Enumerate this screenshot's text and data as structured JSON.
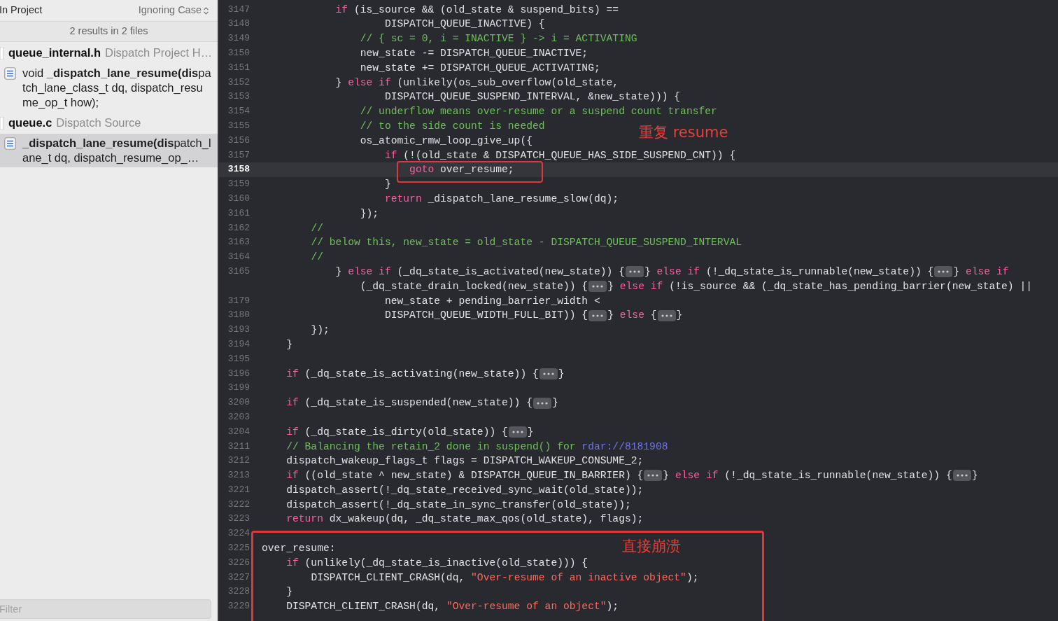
{
  "find_panel": {
    "scope": "In Project",
    "case_option": "Ignoring Case",
    "summary": "2 results in 2 files",
    "results": [
      {
        "kind": "file",
        "name": "queue_internal.h",
        "location": "Dispatch Project H…",
        "selected": false
      },
      {
        "kind": "match",
        "text": "void **_dispatch_lane_resume(dis**patch_lane_class_t dq, dispatch_resume_op_t how);",
        "selected": false
      },
      {
        "kind": "file",
        "name": "queue.c",
        "location": "Dispatch Source",
        "selected": false
      },
      {
        "kind": "match",
        "text": "**_dispatch_lane_resume(dis**patch_lane_t dq, dispatch_resume_op_…",
        "selected": true
      }
    ],
    "filter": {
      "placeholder": "Filter"
    }
  },
  "code_lines": [
    {
      "number": "3147",
      "current": false,
      "segments": [
        {
          "kind": "keyword",
          "text": "            if"
        },
        {
          "kind": "plain",
          "text": " (is_source && (old_state & suspend_bits) =="
        }
      ]
    },
    {
      "number": "3148",
      "current": false,
      "segments": [
        {
          "kind": "plain",
          "text": "                    DISPATCH_QUEUE_INACTIVE) {"
        }
      ]
    },
    {
      "number": "3149",
      "current": false,
      "segments": [
        {
          "kind": "comment",
          "text": "                // { sc = 0, i = INACTIVE } -> i = ACTIVATING"
        }
      ]
    },
    {
      "number": "3150",
      "current": false,
      "segments": [
        {
          "kind": "plain",
          "text": "                new_state -= DISPATCH_QUEUE_INACTIVE;"
        }
      ]
    },
    {
      "number": "3151",
      "current": false,
      "segments": [
        {
          "kind": "plain",
          "text": "                new_state += DISPATCH_QUEUE_ACTIVATING;"
        }
      ]
    },
    {
      "number": "3152",
      "current": false,
      "segments": [
        {
          "kind": "plain",
          "text": "            } "
        },
        {
          "kind": "keyword",
          "text": "else if"
        },
        {
          "kind": "plain",
          "text": " (unlikely(os_sub_overflow(old_state,"
        }
      ]
    },
    {
      "number": "3153",
      "current": false,
      "segments": [
        {
          "kind": "plain",
          "text": "                    DISPATCH_QUEUE_SUSPEND_INTERVAL, &new_state))) {"
        }
      ]
    },
    {
      "number": "3154",
      "current": false,
      "segments": [
        {
          "kind": "comment",
          "text": "                // underflow means over-resume or a suspend count transfer"
        }
      ]
    },
    {
      "number": "3155",
      "current": false,
      "segments": [
        {
          "kind": "comment",
          "text": "                // to the side count is needed"
        }
      ]
    },
    {
      "number": "3156",
      "current": false,
      "segments": [
        {
          "kind": "plain",
          "text": "                os_atomic_rmw_loop_give_up({"
        }
      ]
    },
    {
      "number": "3157",
      "current": false,
      "segments": [
        {
          "kind": "keyword",
          "text": "                    if"
        },
        {
          "kind": "plain",
          "text": " (!(old_state & DISPATCH_QUEUE_HAS_SIDE_SUSPEND_CNT)) {"
        }
      ]
    },
    {
      "number": "3158",
      "current": true,
      "segments": [
        {
          "kind": "keyword",
          "text": "                        goto"
        },
        {
          "kind": "plain",
          "text": " over_resume;"
        }
      ]
    },
    {
      "number": "3159",
      "current": false,
      "segments": [
        {
          "kind": "plain",
          "text": "                    }"
        }
      ]
    },
    {
      "number": "3160",
      "current": false,
      "segments": [
        {
          "kind": "keyword",
          "text": "                    return"
        },
        {
          "kind": "plain",
          "text": " _dispatch_lane_resume_slow(dq);"
        }
      ]
    },
    {
      "number": "3161",
      "current": false,
      "segments": [
        {
          "kind": "plain",
          "text": "                });"
        }
      ]
    },
    {
      "number": "3162",
      "current": false,
      "segments": [
        {
          "kind": "comment",
          "text": "        //"
        }
      ]
    },
    {
      "number": "3163",
      "current": false,
      "segments": [
        {
          "kind": "comment",
          "text": "        // below this, new_state = old_state - DISPATCH_QUEUE_SUSPEND_INTERVAL"
        }
      ]
    },
    {
      "number": "3164",
      "current": false,
      "segments": [
        {
          "kind": "comment",
          "text": "        //"
        }
      ]
    },
    {
      "number": "3165",
      "current": false,
      "segments": [
        {
          "kind": "plain",
          "text": "            } "
        },
        {
          "kind": "keyword",
          "text": "else if"
        },
        {
          "kind": "plain",
          "text": " (_dq_state_is_activated(new_state)) {"
        },
        {
          "kind": "fold"
        },
        {
          "kind": "plain",
          "text": "} "
        },
        {
          "kind": "keyword",
          "text": "else if"
        },
        {
          "kind": "plain",
          "text": " (!_dq_state_is_runnable(new_state)) {"
        },
        {
          "kind": "fold"
        },
        {
          "kind": "plain",
          "text": "} "
        },
        {
          "kind": "keyword",
          "text": "else if"
        }
      ]
    },
    {
      "current": false,
      "segments": [
        {
          "kind": "plain",
          "text": "                (_dq_state_drain_locked(new_state)) {"
        },
        {
          "kind": "fold"
        },
        {
          "kind": "plain",
          "text": "} "
        },
        {
          "kind": "keyword",
          "text": "else if"
        },
        {
          "kind": "plain",
          "text": " (!is_source && (_dq_state_has_pending_barrier(new_state) ||"
        }
      ]
    },
    {
      "number": "3179",
      "current": false,
      "segments": [
        {
          "kind": "plain",
          "text": "                    new_state + pending_barrier_width <"
        }
      ]
    },
    {
      "number": "3180",
      "current": false,
      "segments": [
        {
          "kind": "plain",
          "text": "                    DISPATCH_QUEUE_WIDTH_FULL_BIT)) {"
        },
        {
          "kind": "fold"
        },
        {
          "kind": "plain",
          "text": "} "
        },
        {
          "kind": "keyword",
          "text": "else"
        },
        {
          "kind": "plain",
          "text": " {"
        },
        {
          "kind": "fold"
        },
        {
          "kind": "plain",
          "text": "}"
        }
      ]
    },
    {
      "number": "3193",
      "current": false,
      "segments": [
        {
          "kind": "plain",
          "text": "        });"
        }
      ]
    },
    {
      "number": "3194",
      "current": false,
      "segments": [
        {
          "kind": "plain",
          "text": "    }"
        }
      ]
    },
    {
      "number": "3195",
      "current": false
    },
    {
      "number": "3196",
      "current": false,
      "segments": [
        {
          "kind": "keyword",
          "text": "    if"
        },
        {
          "kind": "plain",
          "text": " (_dq_state_is_activating(new_state)) {"
        },
        {
          "kind": "fold"
        },
        {
          "kind": "plain",
          "text": "}"
        }
      ]
    },
    {
      "number": "3199",
      "current": false
    },
    {
      "number": "3200",
      "current": false,
      "segments": [
        {
          "kind": "keyword",
          "text": "    if"
        },
        {
          "kind": "plain",
          "text": " (_dq_state_is_suspended(new_state)) {"
        },
        {
          "kind": "fold"
        },
        {
          "kind": "plain",
          "text": "}"
        }
      ]
    },
    {
      "number": "3203",
      "current": false
    },
    {
      "number": "3204",
      "current": false,
      "segments": [
        {
          "kind": "keyword",
          "text": "    if"
        },
        {
          "kind": "plain",
          "text": " (_dq_state_is_dirty(old_state)) {"
        },
        {
          "kind": "fold"
        },
        {
          "kind": "plain",
          "text": "}"
        }
      ]
    },
    {
      "number": "3211",
      "current": false,
      "segments": [
        {
          "kind": "comment",
          "text": "    // Balancing the retain_2 done in suspend() for"
        },
        {
          "kind": "link",
          "text": " rdar://8181908"
        }
      ]
    },
    {
      "number": "3212",
      "current": false,
      "segments": [
        {
          "kind": "plain",
          "text": "    dispatch_wakeup_flags_t flags = DISPATCH_WAKEUP_CONSUME_2;"
        }
      ]
    },
    {
      "number": "3213",
      "current": false,
      "segments": [
        {
          "kind": "keyword",
          "text": "    if"
        },
        {
          "kind": "plain",
          "text": " ((old_state ^ new_state) & DISPATCH_QUEUE_IN_BARRIER) {"
        },
        {
          "kind": "fold"
        },
        {
          "kind": "plain",
          "text": "} "
        },
        {
          "kind": "keyword",
          "text": "else if"
        },
        {
          "kind": "plain",
          "text": " (!_dq_state_is_runnable(new_state)) {"
        },
        {
          "kind": "fold"
        },
        {
          "kind": "plain",
          "text": "}"
        }
      ]
    },
    {
      "number": "3221",
      "current": false,
      "segments": [
        {
          "kind": "plain",
          "text": "    dispatch_assert(!_dq_state_received_sync_wait(old_state));"
        }
      ]
    },
    {
      "number": "3222",
      "current": false,
      "segments": [
        {
          "kind": "plain",
          "text": "    dispatch_assert(!_dq_state_in_sync_transfer(old_state));"
        }
      ]
    },
    {
      "number": "3223",
      "current": false,
      "segments": [
        {
          "kind": "keyword",
          "text": "    return"
        },
        {
          "kind": "plain",
          "text": " dx_wakeup(dq, _dq_state_max_qos(old_state), flags);"
        }
      ]
    },
    {
      "number": "3224",
      "current": false
    },
    {
      "number": "3225",
      "current": false,
      "segments": [
        {
          "kind": "plain",
          "text": "over_resume:"
        }
      ]
    },
    {
      "number": "3226",
      "current": false,
      "segments": [
        {
          "kind": "keyword",
          "text": "    if"
        },
        {
          "kind": "plain",
          "text": " (unlikely(_dq_state_is_inactive(old_state))) {"
        }
      ]
    },
    {
      "number": "3227",
      "current": false,
      "segments": [
        {
          "kind": "plain",
          "text": "        DISPATCH_CLIENT_CRASH(dq, "
        },
        {
          "kind": "string",
          "text": "\"Over-resume of an inactive object\""
        },
        {
          "kind": "plain",
          "text": ");"
        }
      ]
    },
    {
      "number": "3228",
      "current": false,
      "segments": [
        {
          "kind": "plain",
          "text": "    }"
        }
      ]
    },
    {
      "number": "3229",
      "current": false,
      "segments": [
        {
          "kind": "plain",
          "text": "    DISPATCH_CLIENT_CRASH(dq, "
        },
        {
          "kind": "string",
          "text": "\"Over-resume of an object\""
        },
        {
          "kind": "plain",
          "text": ");"
        }
      ]
    }
  ],
  "annotations": [
    {
      "text": "重复 resume"
    },
    {
      "text": "直接崩溃"
    }
  ]
}
